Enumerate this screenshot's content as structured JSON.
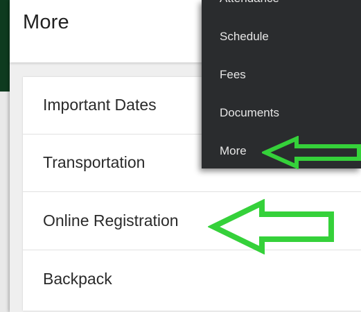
{
  "header": {
    "title": "More"
  },
  "menu": {
    "items": [
      {
        "label": "Important Dates"
      },
      {
        "label": "Transportation"
      },
      {
        "label": "Online Registration"
      },
      {
        "label": "Backpack"
      }
    ]
  },
  "dropdown": {
    "items": [
      {
        "label": "Attendance"
      },
      {
        "label": "Schedule"
      },
      {
        "label": "Fees"
      },
      {
        "label": "Documents"
      },
      {
        "label": "More"
      }
    ]
  },
  "colors": {
    "header_band": "#0e3b1f",
    "dropdown_bg": "#2a2c2e",
    "annotation_arrow": "#35d13a"
  },
  "annotations": {
    "arrows": [
      {
        "icon": "left-arrow-icon",
        "points_to": "dropdown.items.4"
      },
      {
        "icon": "left-arrow-icon",
        "points_to": "menu.items.2"
      }
    ]
  }
}
